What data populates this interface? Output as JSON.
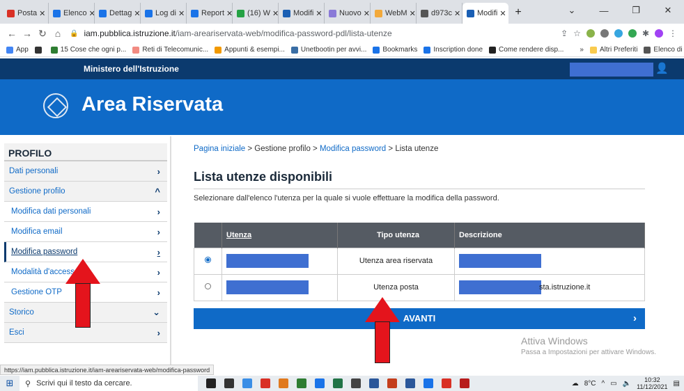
{
  "browser": {
    "tabs": [
      {
        "label": "Posta",
        "color": "#d93025"
      },
      {
        "label": "Elenco",
        "color": "#1a73e8"
      },
      {
        "label": "Dettag",
        "color": "#1a73e8"
      },
      {
        "label": "Log di",
        "color": "#1a73e8"
      },
      {
        "label": "Report",
        "color": "#1a73e8"
      },
      {
        "label": "(16) W",
        "color": "#25a244"
      },
      {
        "label": "Modifi",
        "color": "#1a5fb4"
      },
      {
        "label": "Nuovo",
        "color": "#8a7ad8"
      },
      {
        "label": "WebM",
        "color": "#f2a93b"
      },
      {
        "label": "d973c",
        "color": "#555555"
      },
      {
        "label": "Modifi",
        "color": "#1a5fb4",
        "active": true
      }
    ],
    "new_tab": "+",
    "window_controls": [
      "⌄",
      "—",
      "❐",
      "✕"
    ],
    "url_domain": "iam.pubblica.istruzione.it",
    "url_path": "/iam-areariservata-web/modifica-password-pdl/lista-utenze",
    "bookmarks": [
      {
        "label": "App",
        "color": "#4285f4"
      },
      {
        "label": "",
        "color": "#333333"
      },
      {
        "label": "15 Cose che ogni p...",
        "color": "#2e7d32"
      },
      {
        "label": "Reti di Telecomunic...",
        "color": "#f28b82"
      },
      {
        "label": "Appunti & esempi...",
        "color": "#f29900"
      },
      {
        "label": "Unetbootin per avvi...",
        "color": "#3a6ea5"
      },
      {
        "label": "Bookmarks",
        "color": "#1a73e8"
      },
      {
        "label": "Inscription done",
        "color": "#1a73e8"
      },
      {
        "label": "Come rendere disp...",
        "color": "#222222"
      },
      {
        "label": "»",
        "color": "transparent"
      },
      {
        "label": "Altri Preferiti",
        "color": "#f9cb4f"
      },
      {
        "label": "Elenco di lettura",
        "color": "#555555"
      }
    ],
    "status_url": "https://iam.pubblica.istruzione.it/iam-areariservata-web/modifica-password"
  },
  "site": {
    "ministry": "Ministero dell'Istruzione",
    "area_title": "Area Riservata",
    "sidebar": {
      "header": "PROFILO",
      "items": [
        {
          "label": "Dati personali",
          "chevron": "›",
          "type": "top"
        },
        {
          "label": "Gestione profilo",
          "chevron": "^",
          "type": "top"
        },
        {
          "label": "Modifica dati personali",
          "chevron": "›",
          "type": "sub"
        },
        {
          "label": "Modifica email",
          "chevron": "›",
          "type": "sub"
        },
        {
          "label": "Modifica password",
          "chevron": "›",
          "type": "sub-current"
        },
        {
          "label": "Modalità d'accesso",
          "chevron": "›",
          "type": "sub"
        },
        {
          "label": "Gestione OTP",
          "chevron": "›",
          "type": "sub"
        },
        {
          "label": "Storico",
          "chevron": "⌄",
          "type": "top"
        },
        {
          "label": "Esci",
          "chevron": "›",
          "type": "top"
        }
      ]
    },
    "breadcrumb": {
      "home": "Pagina iniziale",
      "sep": ">",
      "b2": "Gestione profilo",
      "b3": "Modifica password",
      "b4": "Lista utenze"
    },
    "page_title": "Lista utenze disponibili",
    "intro": "Selezionare dall'elenco l'utenza per la quale si vuole effettuare la modifica della password.",
    "table": {
      "headers": [
        "Utenza",
        "Tipo utenza",
        "Descrizione"
      ],
      "rows": [
        {
          "selected": true,
          "type": "Utenza area riservata",
          "desc_suffix": ""
        },
        {
          "selected": false,
          "type": "Utenza posta",
          "desc_suffix": "sta.istruzione.it"
        }
      ]
    },
    "avanti": "AVANTI",
    "watermark_title": "Attiva Windows",
    "watermark_sub": "Passa a Impostazioni per attivare Windows."
  },
  "taskbar": {
    "search_placeholder": "Scrivi qui il testo da cercare.",
    "apps": [
      "#222222",
      "#333333",
      "#3a8ee6",
      "#d93025",
      "#e07a1f",
      "#2e7d32",
      "#1a73e8",
      "#217346",
      "#444444",
      "#2b579a",
      "#c43e1c",
      "#2b579a",
      "#1a73e8",
      "#d93025",
      "#b71c1c"
    ],
    "temperature": "8°C",
    "time": "10:32",
    "date": "11/12/2021"
  },
  "annotations": {
    "color": "#e4141c"
  }
}
